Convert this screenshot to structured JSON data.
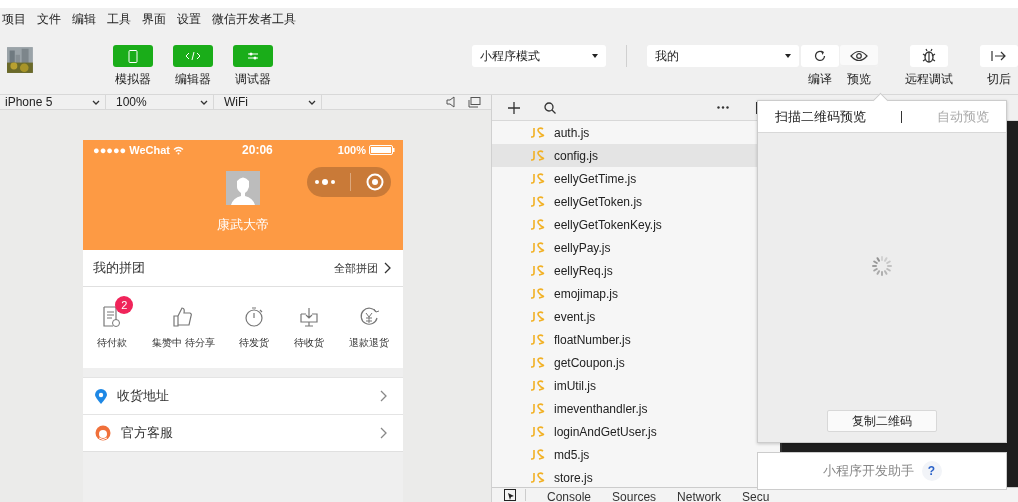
{
  "menu": [
    "项目",
    "文件",
    "编辑",
    "工具",
    "界面",
    "设置",
    "微信开发者工具"
  ],
  "toolbar": {
    "modes": [
      {
        "label": "模拟器",
        "kind": "phone",
        "on": true
      },
      {
        "label": "编辑器",
        "kind": "code",
        "on": true
      },
      {
        "label": "调试器",
        "kind": "sliders",
        "on": true
      }
    ],
    "mode_select": "小程序模式",
    "compile_select": "我的",
    "actions": [
      {
        "label": "编译",
        "kind": "refresh"
      },
      {
        "label": "预览",
        "kind": "eye",
        "selected": true
      },
      {
        "label": "远程调试",
        "kind": "bug"
      },
      {
        "label": "切后",
        "kind": "exit"
      }
    ]
  },
  "simulator_bar": {
    "device": "iPhone 5",
    "zoom": "100%",
    "network": "WiFi"
  },
  "phone": {
    "status": {
      "carrier": "●●●●● WeChat",
      "time": "20:06",
      "battery": "100%"
    },
    "user_name": "康武大帝",
    "group": {
      "title": "我的拼团",
      "link": "全部拼团"
    },
    "orders": [
      {
        "label": "待付款",
        "kind": "receipt",
        "badge": "2"
      },
      {
        "label": "集赞中 待分享",
        "kind": "thumb"
      },
      {
        "label": "待发货",
        "kind": "timer"
      },
      {
        "label": "待收货",
        "kind": "inbox"
      },
      {
        "label": "退款退货",
        "kind": "refund"
      }
    ],
    "links": [
      {
        "label": "收货地址",
        "kind": "pin"
      },
      {
        "label": "官方客服",
        "kind": "service"
      }
    ]
  },
  "files": [
    {
      "name": "auth.js",
      "selected": false
    },
    {
      "name": "config.js",
      "selected": true
    },
    {
      "name": "eellyGetTime.js",
      "selected": false
    },
    {
      "name": "eellyGetToken.js",
      "selected": false
    },
    {
      "name": "eellyGetTokenKey.js",
      "selected": false
    },
    {
      "name": "eellyPay.js",
      "selected": false
    },
    {
      "name": "eellyReq.js",
      "selected": false
    },
    {
      "name": "emojimap.js",
      "selected": false
    },
    {
      "name": "event.js",
      "selected": false
    },
    {
      "name": "floatNumber.js",
      "selected": false
    },
    {
      "name": "getCoupon.js",
      "selected": false
    },
    {
      "name": "imUtil.js",
      "selected": false
    },
    {
      "name": "imeventhandler.js",
      "selected": false
    },
    {
      "name": "loginAndGetUser.js",
      "selected": false
    },
    {
      "name": "md5.js",
      "selected": false
    },
    {
      "name": "store.js",
      "selected": false
    }
  ],
  "devtools_tabs": [
    "Console",
    "Sources",
    "Network",
    "Secu"
  ],
  "preview_popup": {
    "tabs": [
      {
        "label": "扫描二维码预览",
        "selected": true
      },
      {
        "label": "自动预览",
        "selected": false
      }
    ],
    "copy_button": "复制二维码"
  },
  "helper": {
    "label": "小程序开发助手",
    "help": "?"
  }
}
